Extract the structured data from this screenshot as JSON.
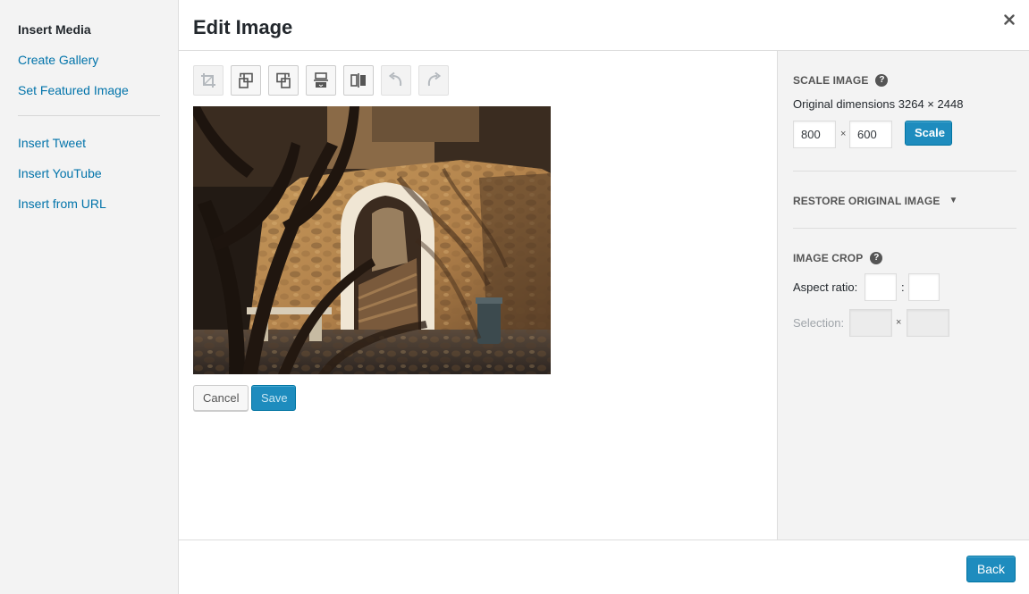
{
  "menu": {
    "items": [
      {
        "label": "Insert Media",
        "active": true
      },
      {
        "label": "Create Gallery"
      },
      {
        "label": "Set Featured Image"
      },
      {
        "label": "Insert Tweet"
      },
      {
        "label": "Insert YouTube"
      },
      {
        "label": "Insert from URL"
      }
    ]
  },
  "title": "Edit Image",
  "close_icon": "close-icon",
  "toolbar": {
    "tools": [
      {
        "name": "crop",
        "icon": "crop-icon",
        "enabled": false
      },
      {
        "name": "rotate-left",
        "icon": "rotate-left-icon",
        "enabled": true
      },
      {
        "name": "rotate-right",
        "icon": "rotate-right-icon",
        "enabled": true
      },
      {
        "name": "flip-vertical",
        "icon": "flip-vertical-icon",
        "enabled": true
      },
      {
        "name": "flip-horizontal",
        "icon": "flip-horizontal-icon",
        "enabled": true
      },
      {
        "name": "undo",
        "icon": "undo-icon",
        "enabled": false
      },
      {
        "name": "redo",
        "icon": "redo-icon",
        "enabled": false
      }
    ]
  },
  "editor": {
    "cancel_label": "Cancel",
    "save_label": "Save"
  },
  "scale": {
    "title": "Scale Image",
    "original_dimensions": "Original dimensions 3264 × 2448",
    "width": "800",
    "height": "600",
    "times": "×",
    "button_label": "Scale"
  },
  "restore": {
    "title": "Restore Original Image"
  },
  "crop": {
    "title": "Image Crop",
    "aspect_label": "Aspect ratio:",
    "aspect_sep": ":",
    "aspect_w": "",
    "aspect_h": "",
    "selection_label": "Selection:",
    "times": "×"
  },
  "footer": {
    "back_label": "Back"
  },
  "colors": {
    "link": "#0073aa",
    "primary": "#1e8cbe",
    "menu_bg": "#f3f3f3"
  }
}
